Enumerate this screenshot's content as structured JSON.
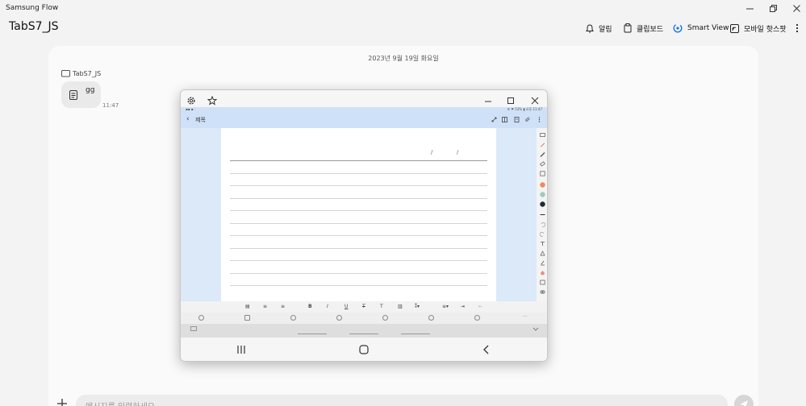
{
  "app": {
    "title": "Samsung Flow"
  },
  "header": {
    "device_name": "TabS7_JS",
    "actions": {
      "notifications": "알림",
      "clipboard": "클립보드",
      "smart_view": "Smart View",
      "mobile_hotspot": "모바일 핫스팟"
    }
  },
  "chat": {
    "date": "2023년 9월 19일 화요일",
    "sender": "TabS7_JS",
    "message": {
      "text": "gg",
      "time": "11:47"
    },
    "input_placeholder": "메시지를 입력하세요"
  },
  "smart_view": {
    "note_title": "제목",
    "status_right": "✉ ⚑ 53% ▮ 오후 11:47"
  },
  "colors": {
    "accent": "#1a73e8",
    "note_header": "#cfe1f8",
    "pen_orange": "#f0895f",
    "pen_teal": "#9ec9c0",
    "pen_navy": "#1f2a38"
  }
}
